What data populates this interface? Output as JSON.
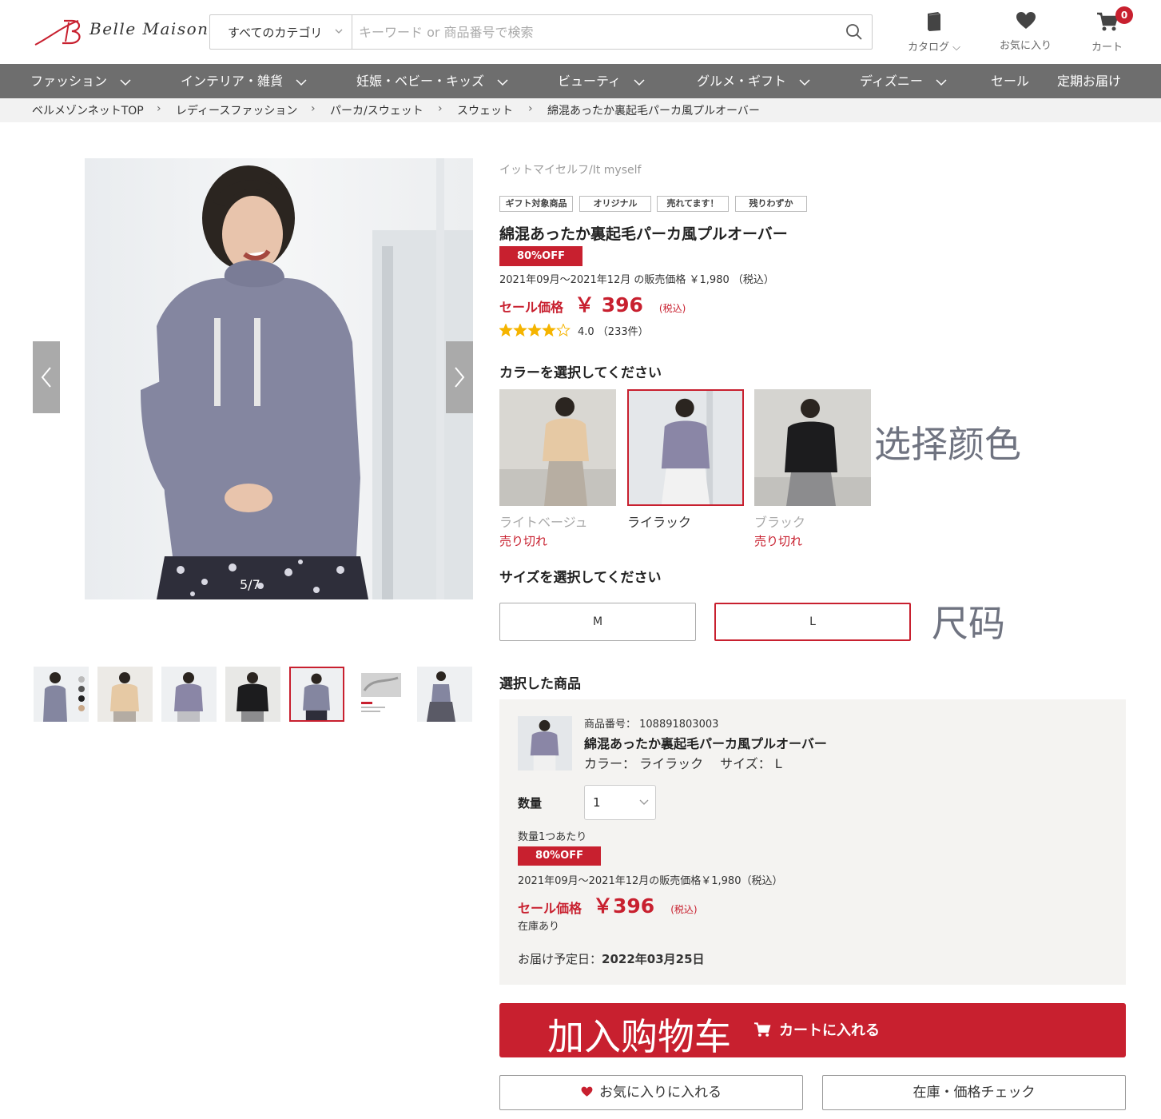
{
  "header": {
    "logo_text": "Belle Maison",
    "search_category": "すべてのカテゴリ",
    "search_placeholder": "キーワード or 商品番号で検索",
    "catalog_label": "カタログ",
    "favorites_label": "お気に入り",
    "cart_label": "カート",
    "cart_count": "0"
  },
  "nav": {
    "items": [
      {
        "label": "ファッション"
      },
      {
        "label": "インテリア・雑貨"
      },
      {
        "label": "妊娠・ベビー・キッズ"
      },
      {
        "label": "ビューティ"
      },
      {
        "label": "グルメ・ギフト"
      },
      {
        "label": "ディズニー"
      },
      {
        "label": "セール"
      },
      {
        "label": "定期お届け"
      }
    ]
  },
  "breadcrumb": [
    "ベルメゾンネットTOP",
    "レディースファッション",
    "パーカ/スウェット",
    "スウェット",
    "綿混あったか裏起毛パーカ風プルオーバー"
  ],
  "gallery": {
    "counter": "5/7",
    "thumb_count": 7,
    "selected_thumb": 5
  },
  "product": {
    "brand": "イットマイセルフ/It myself",
    "tags": [
      "ギフト対象商品",
      "オリジナル",
      "売れてます！",
      "残りわずか"
    ],
    "title": "綿混あったか裏起毛パーカ風プルオーバー",
    "discount": "80%OFF",
    "period_price": "2021年09月～2021年12月 の販売価格 ￥1,980 （税込）",
    "sale_label": "セール価格",
    "sale_price": "￥ 396",
    "tax_label": "(税込)",
    "rating_value": 4.0,
    "rating_text": "4.0 （233件）"
  },
  "color": {
    "heading": "カラーを選択してください",
    "annotation": "选择颜色",
    "options": [
      {
        "name": "ライトベージュ",
        "status": "売り切れ",
        "selected": false
      },
      {
        "name": "ライラック",
        "status": "",
        "selected": true
      },
      {
        "name": "ブラック",
        "status": "売り切れ",
        "selected": false
      }
    ]
  },
  "size": {
    "heading": "サイズを選択してください",
    "annotation": "尺码",
    "options": [
      {
        "label": "M",
        "selected": false
      },
      {
        "label": "L",
        "selected": true
      }
    ]
  },
  "selected": {
    "heading": "選択した商品",
    "item_no": "商品番号： 108891803003",
    "title": "綿混あったか裏起毛パーカ風プルオーバー",
    "color_size": "カラー： ライラック　 サイズ： L",
    "qty_label": "数量",
    "qty_value": "1",
    "per_unit": "数量1つあたり",
    "discount": "80%OFF",
    "period_price": "2021年09月～2021年12月の販売価格￥1,980（税込）",
    "sale_label": "セール価格",
    "sale_price": "￥396",
    "tax_label": "(税込)",
    "stock": "在庫あり",
    "delivery_label": "お届け予定日：",
    "delivery_date": "2022年03月25日"
  },
  "actions": {
    "cart_annotation": "加入购物车",
    "cart_label": "カートに入れる",
    "favorite_label": "お気に入りに入れる",
    "stock_check_label": "在庫・価格チェック"
  },
  "colors": {
    "accent": "#c8202f",
    "nav_bg": "#6e6e6e",
    "sweater": "#8486a0"
  }
}
